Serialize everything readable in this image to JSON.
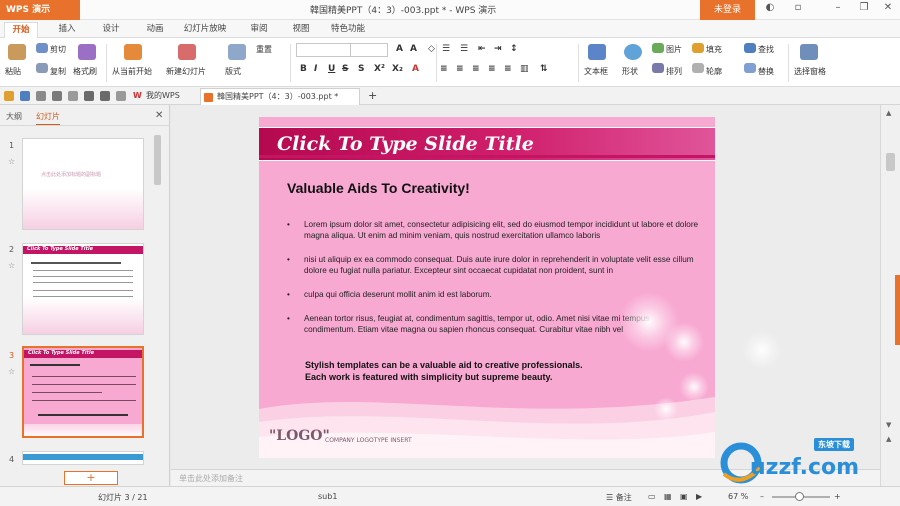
{
  "titlebar": {
    "app_button": "WPS 演示",
    "doc_title": "韓国精美PPT（4：3）-003.ppt * - WPS 演示",
    "login_button": "未登录",
    "controls": [
      "minimize-icon",
      "restore-icon",
      "close-icon"
    ]
  },
  "menu_tabs": [
    "开始",
    "插入",
    "设计",
    "动画",
    "幻灯片放映",
    "审阅",
    "视图",
    "特色功能"
  ],
  "active_tab": "开始",
  "ribbon": {
    "paste": "粘贴",
    "cut": "剪切",
    "copy": "复制",
    "format_painter": "格式刷",
    "from_current": "从当前开始",
    "new_slide": "新建幻灯片",
    "layout": "版式",
    "reset": "重置",
    "font_name": "",
    "font_size": "",
    "bold": "B",
    "italic": "I",
    "underline": "U",
    "strike": "S",
    "textbox": "文本框",
    "shape": "形状",
    "picture": "图片",
    "arrange": "排列",
    "fill": "填充",
    "outline": "轮廓",
    "find": "查找",
    "replace": "替换",
    "select_pane": "选择窗格"
  },
  "quickbar": {
    "tab1": "我的WPS",
    "tab2": "韓国精美PPT（4：3）-003.ppt *",
    "add_tab": "+"
  },
  "slide_panel": {
    "tab_outline": "大纲",
    "tab_slides": "幻灯片",
    "thumbs": [
      {
        "num": "1",
        "text": "点击此处添加标题的副标题"
      },
      {
        "num": "2",
        "text": "Click To Type Slide Title"
      },
      {
        "num": "3",
        "text": "Click To Type Slide Title"
      },
      {
        "num": "4",
        "text": ""
      }
    ],
    "add_button": "+"
  },
  "slide": {
    "title": "Click To Type Slide Title",
    "heading": "Valuable Aids To Creativity!",
    "bullets": [
      "Lorem ipsum dolor sit amet, consectetur adipisicing elit, sed do eiusmod tempor incididunt ut labore et dolore magna aliqua. Ut enim ad minim veniam, quis nostrud exercitation ullamco laboris",
      "nisi ut aliquip ex ea commodo consequat. Duis aute irure dolor in reprehenderit in voluptate velit esse cillum dolore eu fugiat nulla pariatur. Excepteur sint occaecat cupidatat non proident, sunt in",
      "culpa qui officia deserunt mollit anim id est laborum.",
      "Aenean tortor risus, feugiat at, condimentum sagittis, tempor ut, odio. Amet nisi vitae mi tempus condimentum. Etiam vitae magna ou sapien rhoncus consequat. Curabitur vitae nibh vel"
    ],
    "tagline_1": "Stylish templates can be a valuable aid to creative professionals.",
    "tagline_2": "Each work is featured with simplicity but supreme beauty.",
    "logo": "\"LOGO\"",
    "company": "COMPANY LOGOTYPE INSERT"
  },
  "notes_placeholder": "单击此处添加备注",
  "statusbar": {
    "slide_counter": "幻灯片 3 / 21",
    "theme": "sub1",
    "notes_toggle": "备注",
    "zoom": "67 %"
  },
  "watermark": {
    "brand": "uzzf.com",
    "tag": "东坡下载"
  },
  "colors": {
    "accent": "#e8712b",
    "slide_bg": "#f8a9d2",
    "title_band": "#c41464"
  }
}
